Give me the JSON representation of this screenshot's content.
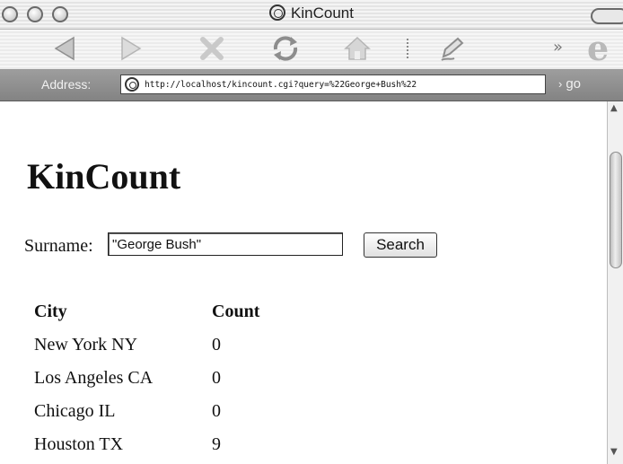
{
  "window": {
    "title": "KinCount",
    "title_icon": "globe-icon"
  },
  "toolbar": {
    "buttons": [
      {
        "name": "back",
        "icon": "back-arrow-icon"
      },
      {
        "name": "forward",
        "icon": "forward-arrow-icon"
      },
      {
        "name": "stop",
        "icon": "stop-icon"
      },
      {
        "name": "refresh",
        "icon": "refresh-icon"
      },
      {
        "name": "home",
        "icon": "home-icon"
      },
      {
        "name": "autofill",
        "icon": "autofill-pen-icon"
      }
    ],
    "overflow_label": "»",
    "logo": "e"
  },
  "address_bar": {
    "label": "Address:",
    "url": "http://localhost/kincount.cgi?query=%22George+Bush%22",
    "go_arrow": "›",
    "go_label": "go"
  },
  "page": {
    "heading": "KinCount",
    "search": {
      "label": "Surname:",
      "value": "\"George Bush\"",
      "button_label": "Search"
    },
    "results": {
      "headers": [
        "City",
        "Count"
      ],
      "rows": [
        {
          "city": "New York NY",
          "count": "0"
        },
        {
          "city": "Los Angeles CA",
          "count": "0"
        },
        {
          "city": "Chicago IL",
          "count": "0"
        },
        {
          "city": "Houston TX",
          "count": "9"
        }
      ]
    }
  },
  "scrollbar": {
    "up_arrow": "▲",
    "down_arrow": "▼"
  },
  "colors": {
    "address_bar_bg": "#8f8f8f",
    "toolbar_icon": "#bdbdbd",
    "page_bg": "#ffffff"
  }
}
